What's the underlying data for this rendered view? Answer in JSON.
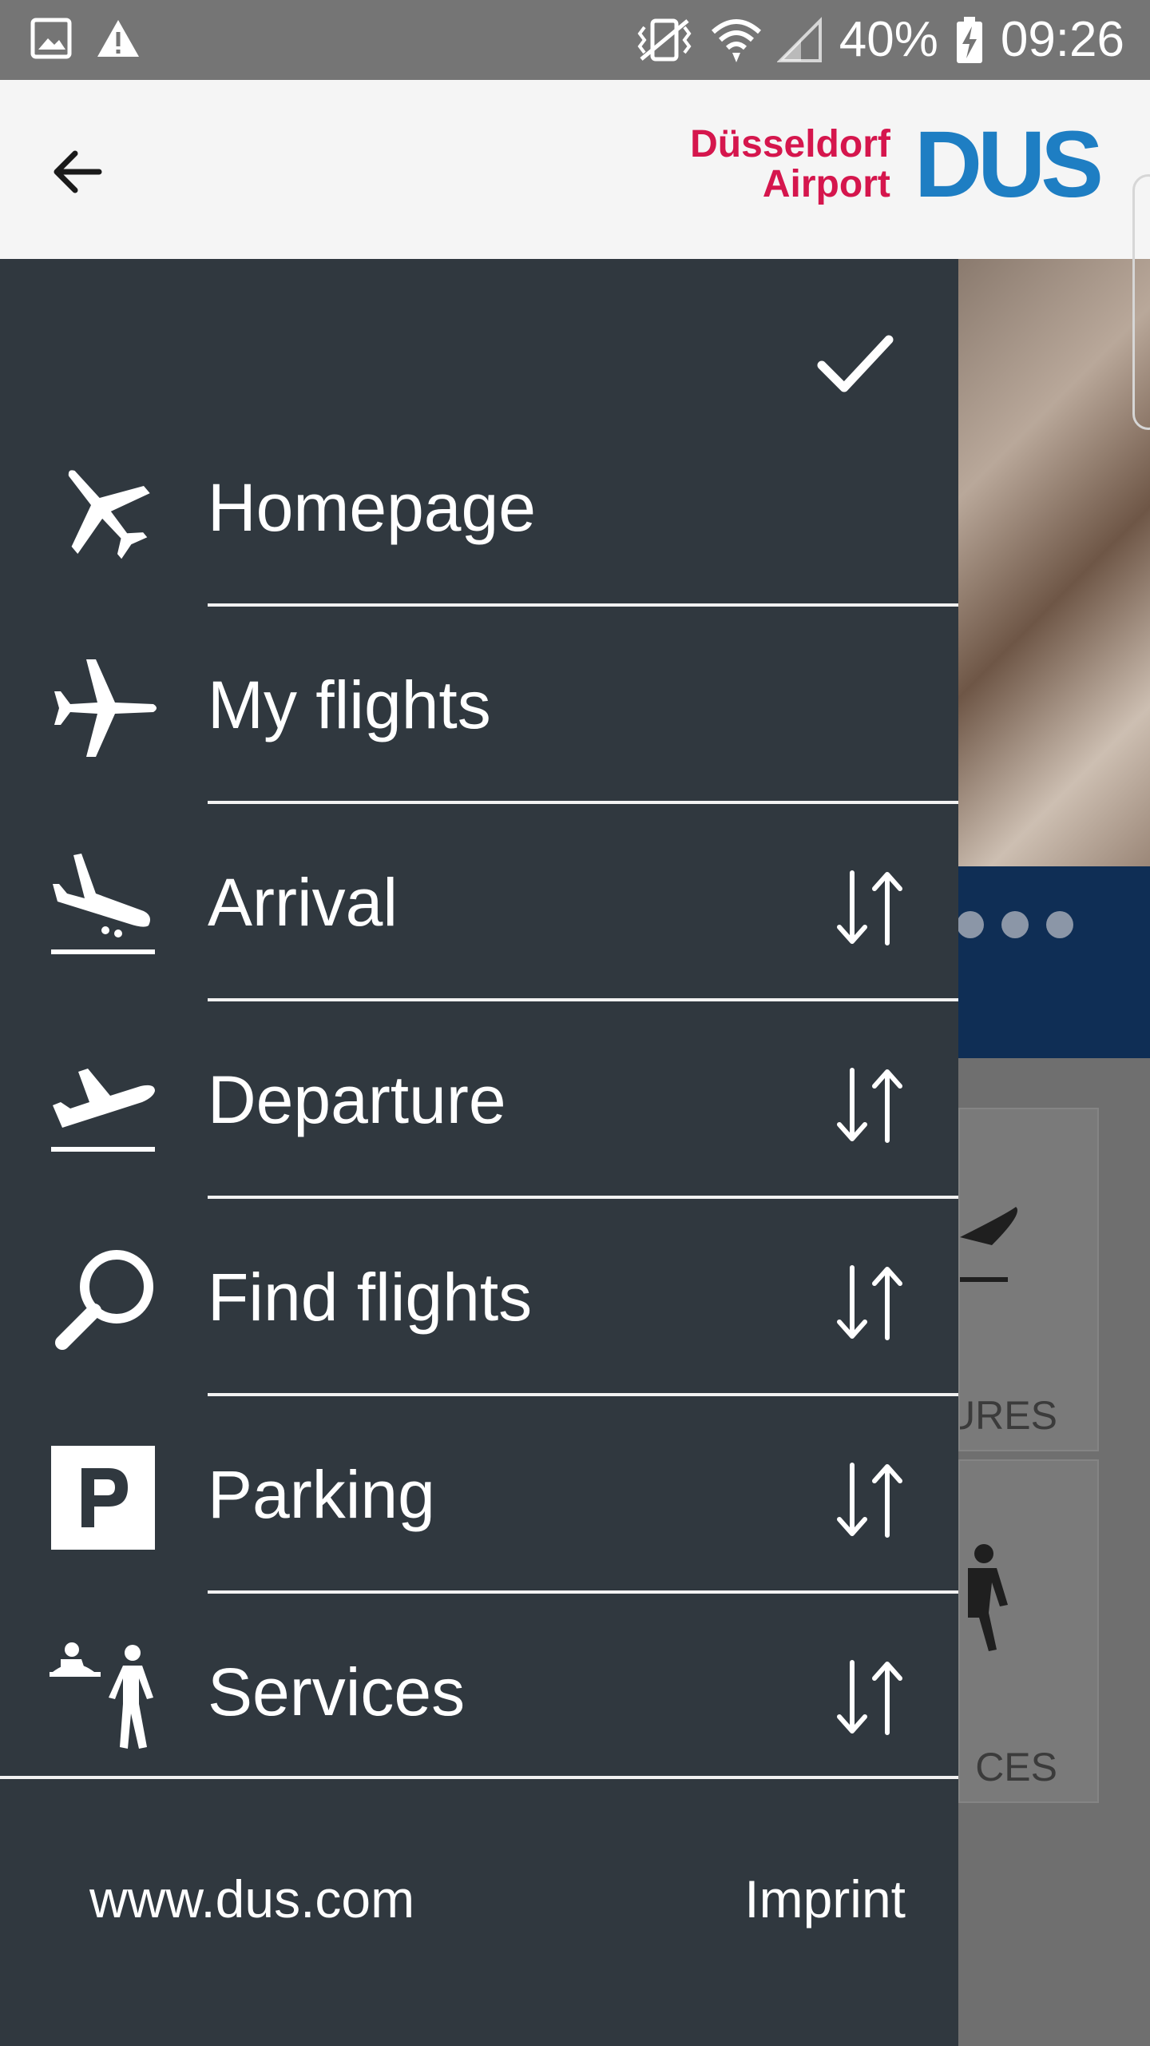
{
  "status_bar": {
    "battery": "40%",
    "time": "09:26",
    "left_icons": [
      "image-icon",
      "warning-icon"
    ],
    "right_icons": [
      "vibrate-icon",
      "wifi-icon",
      "signal-icon",
      "battery-charging-icon"
    ]
  },
  "header": {
    "back_icon": "back-arrow-icon",
    "brand_line1": "Düsseldorf",
    "brand_line2": "Airport",
    "brand_mark": "DUS",
    "brand_colors": {
      "words": "#d5164d",
      "mark": "#1e7ec3"
    }
  },
  "drawer": {
    "close_icon": "check-icon",
    "items": [
      {
        "label": "Homepage",
        "icon": "airplane-icon",
        "sortable": false
      },
      {
        "label": "My flights",
        "icon": "airplane-side-icon",
        "sortable": false
      },
      {
        "label": "Arrival",
        "icon": "plane-landing-icon",
        "sortable": true
      },
      {
        "label": "Departure",
        "icon": "plane-takeoff-icon",
        "sortable": true
      },
      {
        "label": "Find flights",
        "icon": "search-icon",
        "sortable": true
      },
      {
        "label": "Parking",
        "icon": "parking-icon",
        "sortable": true
      },
      {
        "label": "Services",
        "icon": "services-icon",
        "sortable": true
      }
    ],
    "sort_icon": "sort-arrows-icon",
    "footer": {
      "website": "www.dus.com",
      "imprint": "Imprint"
    },
    "colors": {
      "background": "#30383f",
      "text": "#ffffff"
    }
  },
  "background_content": {
    "tile_1_label": "URES",
    "tile_2_label": "CES"
  }
}
